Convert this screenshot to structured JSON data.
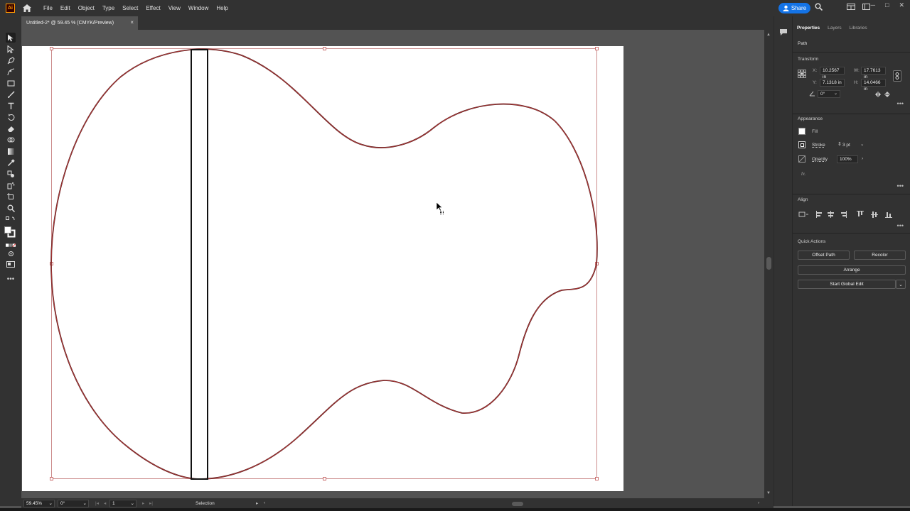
{
  "menubar": {
    "app_logo": "Ai",
    "items": [
      "File",
      "Edit",
      "Object",
      "Type",
      "Select",
      "Effect",
      "View",
      "Window",
      "Help"
    ],
    "share_label": "Share"
  },
  "document": {
    "tab_title": "Untitled-2* @ 59.45 % (CMYK/Preview)",
    "close_glyph": "×"
  },
  "panel": {
    "tabs": [
      "Properties",
      "Layers",
      "Libraries"
    ],
    "object_type": "Path",
    "transform": {
      "title": "Transform",
      "x_label": "X:",
      "x_value": "10.2567 in",
      "y_label": "Y:",
      "y_value": "7.1318 in",
      "w_label": "W:",
      "w_value": "17.7613 in",
      "h_label": "H:",
      "h_value": "14.0466 in",
      "angle_value": "0°"
    },
    "appearance": {
      "title": "Appearance",
      "fill_label": "Fill",
      "stroke_label": "Stroke",
      "stroke_value": "3 pt",
      "opacity_label": "Opacity",
      "opacity_value": "100%",
      "fx_label": "fx."
    },
    "align": {
      "title": "Align"
    },
    "quick_actions": {
      "title": "Quick Actions",
      "offset_path": "Offset Path",
      "recolor": "Recolor",
      "arrange": "Arrange",
      "start_global_edit": "Start Global Edit"
    }
  },
  "statusbar": {
    "zoom": "59.45%",
    "rotation": "0°",
    "artboard_number": "1",
    "tool_name": "Selection"
  },
  "colors": {
    "accent": "#1473e6",
    "path_selection": "#c0392b",
    "ui_dark": "#323232",
    "canvas_bg": "#535353"
  }
}
